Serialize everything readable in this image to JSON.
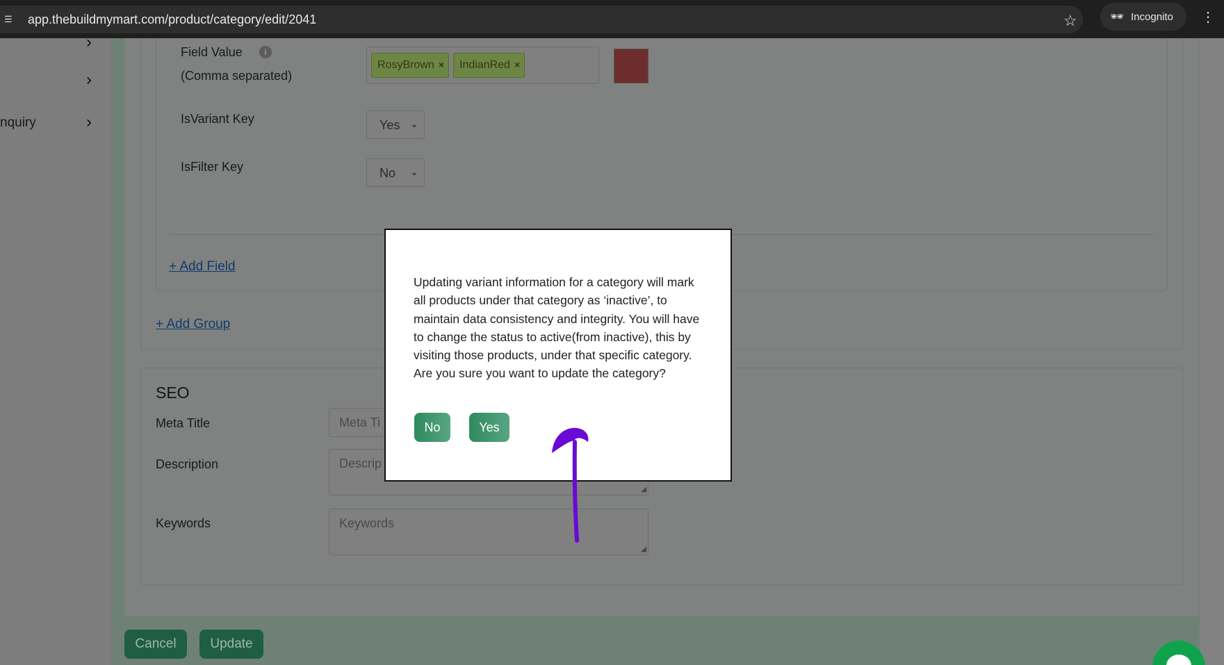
{
  "browser": {
    "url": "app.thebuildmymart.com/product/category/edit/2041",
    "profile_label": "Incognito"
  },
  "sidebar": {
    "items": [
      {
        "label": ""
      },
      {
        "label": "nquiry"
      }
    ]
  },
  "variant_field": {
    "field_value_label": "Field Value",
    "field_value_hint": "(Comma separated)",
    "tags": [
      "RosyBrown",
      "IndianRed"
    ],
    "tag_remove": "×",
    "swatch_color": "#6e2d2d",
    "is_variant_label": "IsVariant Key",
    "is_variant_value": "Yes",
    "is_filter_label": "IsFilter Key",
    "is_filter_value": "No",
    "add_field_link": "+ Add Field",
    "add_group_link": "+ Add Group"
  },
  "seo": {
    "title": "SEO",
    "meta_title_label": "Meta Title",
    "meta_title_placeholder": "Meta Ti",
    "description_label": "Description",
    "description_placeholder": "Descrip",
    "keywords_label": "Keywords",
    "keywords_placeholder": "Keywords"
  },
  "actions": {
    "cancel_label": "Cancel",
    "update_label": "Update"
  },
  "modal": {
    "message": "Updating variant information for a category will mark all products under that category as ‘inactive’, to maintain data consistency and integrity. You will have to change the status to active(from inactive), this by visiting those products, under that specific category. Are you sure you want to update the category?",
    "no_label": "No",
    "yes_label": "Yes"
  },
  "icons": {
    "star": "☆",
    "menu": "⋮",
    "chevron": "›",
    "info": "i",
    "caret": "⌄"
  },
  "colors": {
    "accent_green": "#2e8a5d",
    "annotation_purple": "#6a0ad6",
    "chat_green": "#0ea34a"
  }
}
